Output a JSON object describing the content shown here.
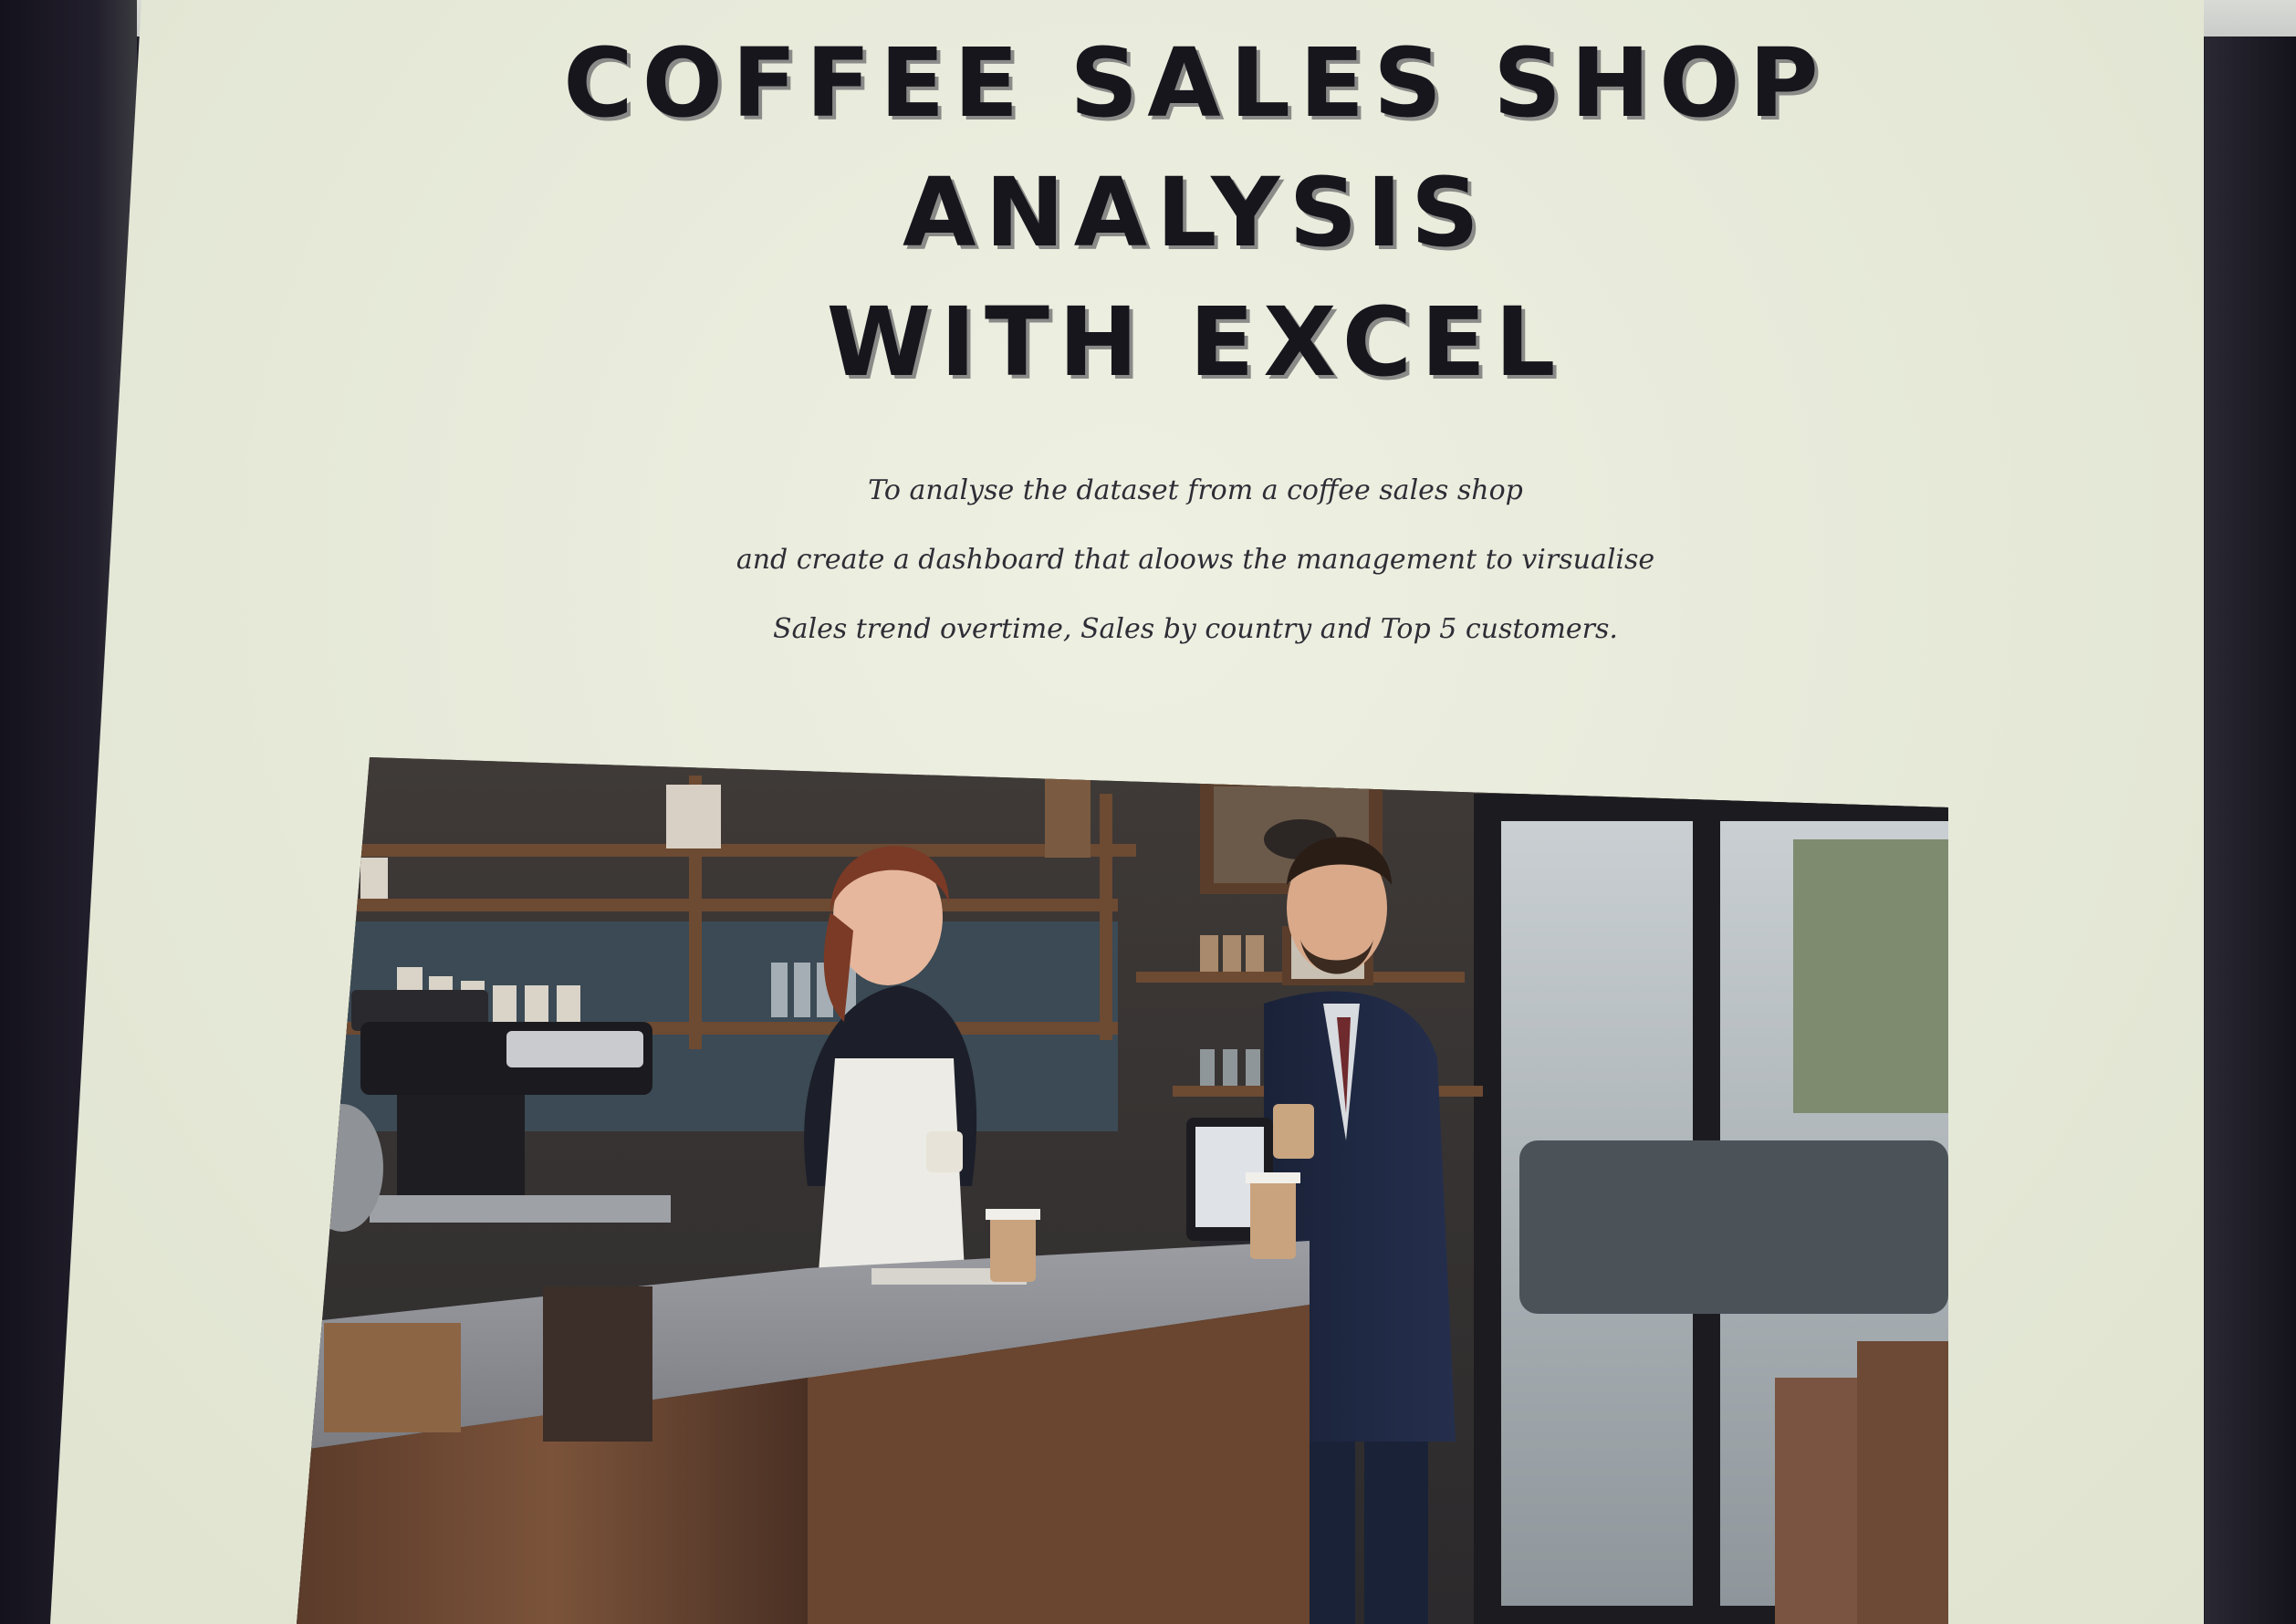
{
  "page": {
    "title_lines": [
      "COFFEE SALES SHOP",
      "ANALYSIS",
      "WITH EXCEL"
    ],
    "description_lines": [
      "To analyse the dataset from a coffee sales shop",
      "and create a dashboard that aloows the management to virsualise",
      "Sales trend overtime, Sales by country and Top 5 customers."
    ]
  },
  "colors": {
    "screen_background": "#e6e9d8",
    "title_text": "#17161d",
    "title_shadow": "#8a8a88",
    "body_text": "#2e2d36"
  }
}
